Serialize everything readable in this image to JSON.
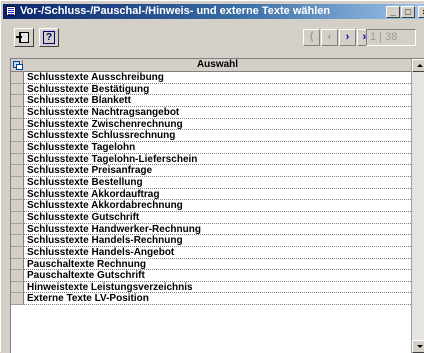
{
  "window": {
    "title": "Vor-/Schluss-/Pauschal-/Hinweis- und externe Texte wählen",
    "icon": "table-window-icon",
    "minimize_glyph": "_",
    "maximize_glyph": "□",
    "close_glyph": "×"
  },
  "toolbar": {
    "exit_icon": "exit-door-icon",
    "help_label": "?",
    "nav": {
      "first_glyph": "⟨",
      "prev_glyph": "‹",
      "next_glyph": "›",
      "last_glyph": "»",
      "counter": "1 | 38"
    }
  },
  "grid": {
    "header_icon": "copy-rows-icon",
    "column_header": "Auswahl",
    "rows": [
      "Schlusstexte Ausschreibung",
      "Schlusstexte Bestätigung",
      "Schlusstexte Blankett",
      "Schlusstexte Nachtragsangebot",
      "Schlusstexte Zwischenrechnung",
      "Schlusstexte Schlussrechnung",
      "Schlusstexte Tagelohn",
      "Schlusstexte Tagelohn-Lieferschein",
      "Schlusstexte Preisanfrage",
      "Schlusstexte Bestellung",
      "Schlusstexte Akkordauftrag",
      "Schlusstexte Akkordabrechnung",
      "Schlusstexte Gutschrift",
      "Schlusstexte Handwerker-Rechnung",
      "Schlusstexte Handels-Rechnung",
      "Schlusstexte Handels-Angebot",
      "Pauschaltexte Rechnung",
      "Pauschaltexte Gutschrift",
      "Hinweistexte Leistungsverzeichnis",
      "Externe Texte LV-Position"
    ]
  },
  "colors": {
    "titlebar_start": "#0a246a",
    "titlebar_end": "#a6caf0",
    "nav_active": "#0000cc",
    "chrome": "#d4d0c8"
  }
}
